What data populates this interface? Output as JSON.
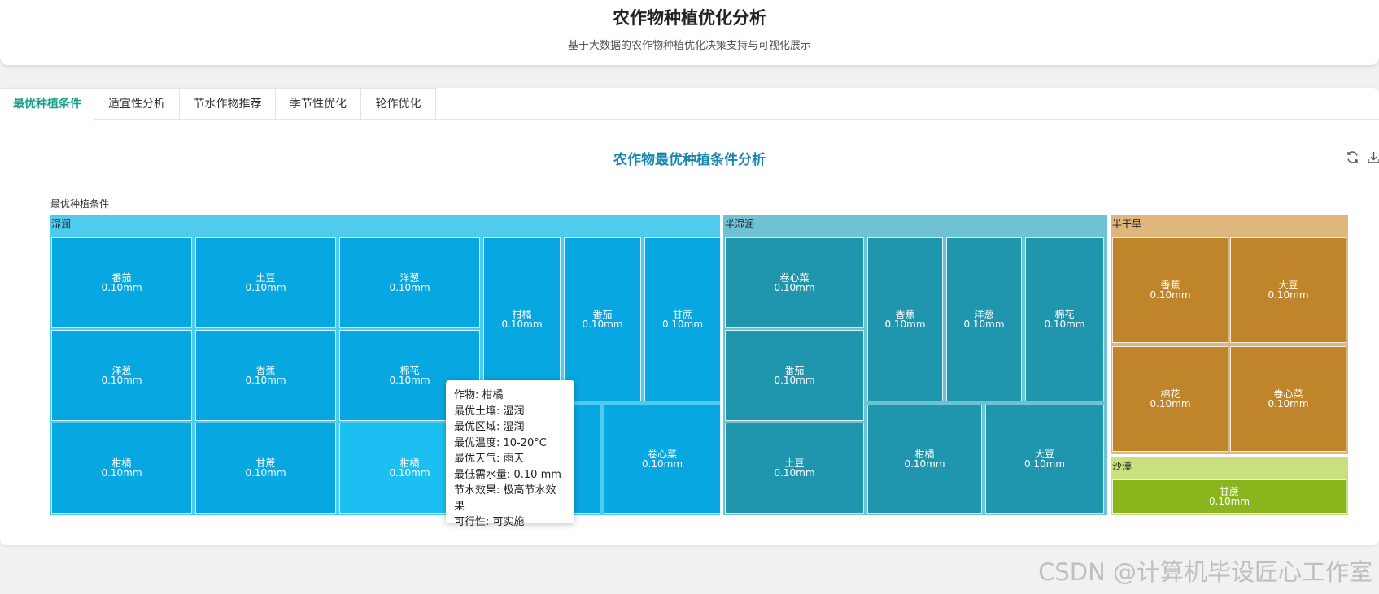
{
  "header": {
    "title": "农作物种植优化分析",
    "subtitle": "基于大数据的农作物种植优化决策支持与可视化展示"
  },
  "tabs": [
    {
      "label": "最优种植条件",
      "active": true
    },
    {
      "label": "适宜性分析",
      "active": false
    },
    {
      "label": "节水作物推荐",
      "active": false
    },
    {
      "label": "季节性优化",
      "active": false
    },
    {
      "label": "轮作优化",
      "active": false
    }
  ],
  "toolbox": {
    "restore_icon": "refresh-icon",
    "download_icon": "download-icon"
  },
  "colors": {
    "accent": "#1aa085",
    "chart_title": "#1a86b0",
    "humid": "#07a7e1",
    "semi_humid": "#1f96ae",
    "semi_arid": "#c0852b",
    "desert": "#8bb51c"
  },
  "chart_data": {
    "type": "treemap",
    "title": "农作物最优种植条件分析",
    "root_label": "最优种植条件",
    "unit": "mm",
    "groups": [
      {
        "name": "湿润",
        "children": [
          {
            "name": "番茄",
            "value": 0.1
          },
          {
            "name": "土豆",
            "value": 0.1
          },
          {
            "name": "洋葱",
            "value": 0.1
          },
          {
            "name": "柑橘",
            "value": 0.1
          },
          {
            "name": "番茄",
            "value": 0.1
          },
          {
            "name": "甘蔗",
            "value": 0.1
          },
          {
            "name": "洋葱",
            "value": 0.1
          },
          {
            "name": "香蕉",
            "value": 0.1
          },
          {
            "name": "棉花",
            "value": 0.1
          },
          {
            "name": "柑橘",
            "value": 0.1
          },
          {
            "name": "甘蔗",
            "value": 0.1
          },
          {
            "name": "柑橘",
            "value": 0.1
          },
          {
            "name": "土豆",
            "value": 0.1
          },
          {
            "name": "卷心菜",
            "value": 0.1
          }
        ]
      },
      {
        "name": "半湿润",
        "children": [
          {
            "name": "卷心菜",
            "value": 0.1
          },
          {
            "name": "香蕉",
            "value": 0.1
          },
          {
            "name": "洋葱",
            "value": 0.1
          },
          {
            "name": "棉花",
            "value": 0.1
          },
          {
            "name": "番茄",
            "value": 0.1
          },
          {
            "name": "土豆",
            "value": 0.1
          },
          {
            "name": "柑橘",
            "value": 0.1
          },
          {
            "name": "大豆",
            "value": 0.1
          }
        ]
      },
      {
        "name": "半干旱",
        "children": [
          {
            "name": "香蕉",
            "value": 0.1
          },
          {
            "name": "大豆",
            "value": 0.1
          },
          {
            "name": "棉花",
            "value": 0.1
          },
          {
            "name": "卷心菜",
            "value": 0.1
          }
        ]
      },
      {
        "name": "沙漠",
        "children": [
          {
            "name": "甘蔗",
            "value": 0.1
          }
        ]
      }
    ],
    "value_labels": [
      "0.10mm",
      "0.10mm",
      "0.10mm",
      "0.10mm",
      "0.10mm",
      "0.10mm",
      "0.10mm",
      "0.10mm",
      "0.10mm",
      "0.10mm",
      "0.10mm",
      "0.10mm",
      "0.10mm",
      "0.10mm",
      "0.10mm",
      "0.10mm",
      "0.10mm",
      "0.10mm",
      "0.10mm",
      "0.10mm",
      "0.10mm",
      "0.10mm",
      "0.10mm",
      "0.10mm",
      "0.10mm",
      "0.10mm",
      "0.10mm"
    ]
  },
  "tooltip": {
    "lines": [
      "作物: 柑橘",
      "最优土壤: 湿润",
      "最优区域: 湿润",
      "最优温度: 10-20°C",
      "最优天气: 雨天",
      "最低需水量: 0.10 mm",
      "节水效果: 极高节水效果",
      "可行性: 可实施"
    ]
  },
  "watermark": "CSDN @计算机毕设匠心工作室"
}
